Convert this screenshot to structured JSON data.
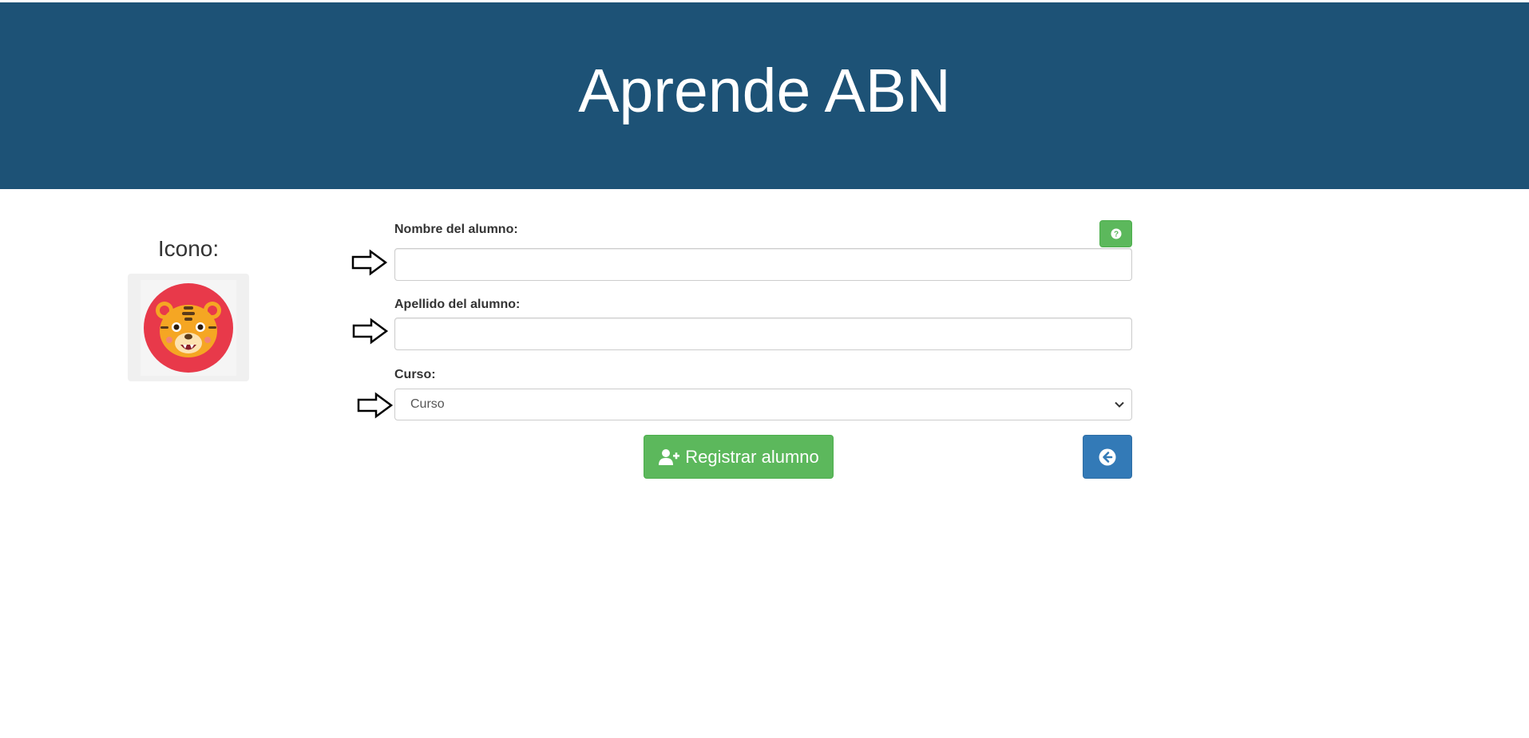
{
  "header": {
    "title": "Aprende ABN",
    "background": "#1d5276"
  },
  "icon_panel": {
    "label": "Icono:",
    "avatar": "tiger-face-icon"
  },
  "form": {
    "nombre": {
      "label": "Nombre del alumno:",
      "value": "",
      "placeholder": ""
    },
    "apellido": {
      "label": "Apellido del alumno:",
      "value": "",
      "placeholder": ""
    },
    "curso": {
      "label": "Curso:",
      "selected": "Curso"
    }
  },
  "buttons": {
    "help": {
      "icon": "question-circle-icon",
      "color": "#5cb85c"
    },
    "register": {
      "label": "Registrar alumno",
      "icon": "user-plus-icon",
      "color": "#5cb85c"
    },
    "back": {
      "icon": "arrow-circle-left-icon",
      "color": "#337ab7"
    }
  },
  "hint_arrows": {
    "icon": "right-arrow-outline-icon"
  }
}
